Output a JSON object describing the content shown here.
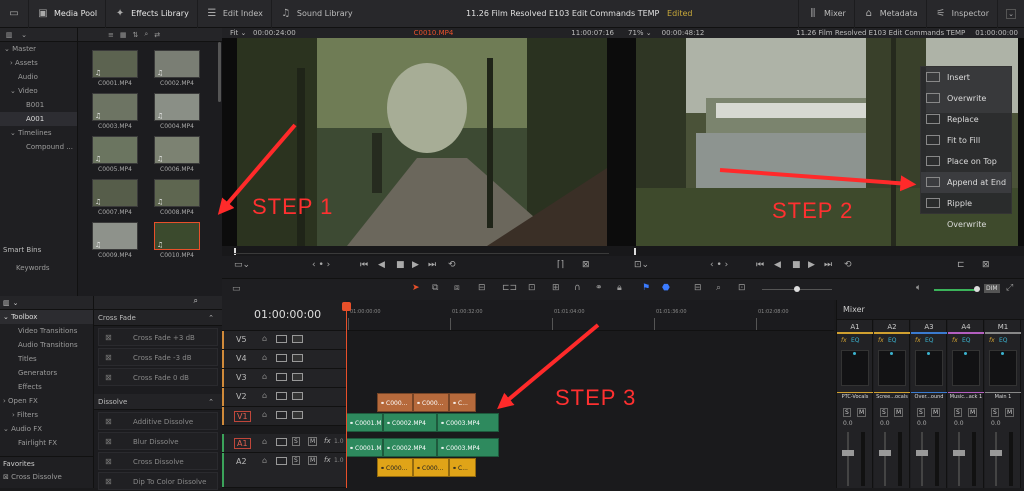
{
  "topbar": {
    "media_pool": "Media Pool",
    "effects_library": "Effects Library",
    "edit_index": "Edit Index",
    "sound_library": "Sound Library",
    "project_title": "11.26 Film Resolved E103 Edit Commands TEMP",
    "project_status": "Edited",
    "mixer": "Mixer",
    "metadata": "Metadata",
    "inspector": "Inspector"
  },
  "source_viewer": {
    "zoom": "Fit",
    "timecode_left": "00:00:24:00",
    "clip_name": "C0010.MP4",
    "timecode_right": "11:00:07:16"
  },
  "timeline_viewer": {
    "zoom": "71%",
    "timecode_left": "00:00:48:12",
    "timeline_name": "11.26 Film Resolved E103 Edit Commands TEMP",
    "timecode_right": "01:00:00:00"
  },
  "media_tree": {
    "master": "Master",
    "assets": "Assets",
    "audio": "Audio",
    "video": "Video",
    "b001": "B001",
    "a001": "A001",
    "timelines": "Timelines",
    "compound": "Compound ...",
    "smart_bins": "Smart Bins",
    "keywords": "Keywords"
  },
  "clips": [
    "C0001.MP4",
    "C0002.MP4",
    "C0003.MP4",
    "C0004.MP4",
    "C0005.MP4",
    "C0006.MP4",
    "C0007.MP4",
    "C0008.MP4",
    "C0009.MP4",
    "C0010.MP4"
  ],
  "toolbox_tree": {
    "toolbox": "Toolbox",
    "video_transitions": "Video Transitions",
    "audio_transitions": "Audio Transitions",
    "titles": "Titles",
    "generators": "Generators",
    "effects": "Effects",
    "open_fx": "Open FX",
    "filters": "Filters",
    "audio_fx": "Audio FX",
    "fairlight_fx": "Fairlight FX",
    "favorites": "Favorites",
    "cross_dissolve_fav": "Cross Dissolve"
  },
  "effects_list": {
    "cross_fade_header": "Cross Fade",
    "cross_fade_items": [
      "Cross Fade +3 dB",
      "Cross Fade -3 dB",
      "Cross Fade 0 dB"
    ],
    "dissolve_header": "Dissolve",
    "dissolve_items": [
      "Additive Dissolve",
      "Blur Dissolve",
      "Cross Dissolve",
      "Dip To Color Dissolve"
    ]
  },
  "overlay_menu": [
    "Insert",
    "Overwrite",
    "Replace",
    "Fit to Fill",
    "Place on Top",
    "Append at End",
    "Ripple Overwrite"
  ],
  "annotations": {
    "step1": "STEP 1",
    "step2": "STEP 2",
    "step3": "STEP 3"
  },
  "timeline": {
    "timecode": "01:00:00:00",
    "ruler": [
      "01:00:00:00",
      "01:00:32:00",
      "01:01:04:00",
      "01:01:36:00",
      "01:02:08:00"
    ],
    "tracks": [
      "V5",
      "V4",
      "V3",
      "V2",
      "V1",
      "A1",
      "A2"
    ],
    "v2_clips": [
      "C000...",
      "C000...",
      "C..."
    ],
    "v1_clips": [
      "C0001.MP4",
      "C0002.MP4",
      "C0003.MP4"
    ],
    "a1_clips": [
      "C0001.MP4",
      "C0002.MP4",
      "C0003.MP4"
    ],
    "a2_clips": [
      "C000...",
      "C000...",
      "C..."
    ],
    "fx_label": "fx",
    "level": "1.0",
    "solo": "S",
    "mute": "M"
  },
  "mixer": {
    "title": "Mixer",
    "channels": [
      "A1",
      "A2",
      "A3",
      "A4",
      "M1"
    ],
    "eq_label": "EQ",
    "fx_label": "fx",
    "names": [
      "PTC-Vocals",
      "Scree...ocals",
      "Over...ound",
      "Music...ack 1",
      "Main 1"
    ],
    "levels": [
      "0.0",
      "0.0",
      "0.0",
      "0.0",
      "0.0"
    ]
  },
  "colors": {
    "accent": "#e8502a",
    "clip_video": "#2e8a5e",
    "clip_orange": "#b66a3c",
    "clip_yellow": "#e0a418",
    "step_red": "#ff3030"
  }
}
